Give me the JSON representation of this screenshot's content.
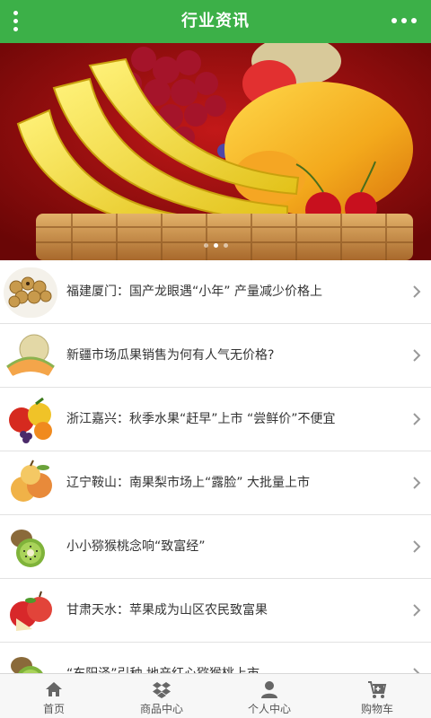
{
  "header": {
    "title": "行业资讯",
    "menu_icon": "vertical-dots-icon",
    "more_icon": "horizontal-dots-icon",
    "bar_color": "#3cb048"
  },
  "banner": {
    "slides": 3,
    "active_slide": 2
  },
  "news": [
    {
      "title": "福建厦门：国产龙眼遇“小年” 产量减少价格上",
      "thumb": "longan"
    },
    {
      "title": "新疆市场瓜果销售为何有人气无价格?",
      "thumb": "melon"
    },
    {
      "title": "浙江嘉兴：秋季水果“赶早”上市 “尝鲜价”不便宜",
      "thumb": "mixed-fruit"
    },
    {
      "title": "辽宁鞍山：南果梨市场上“露脸” 大批量上市",
      "thumb": "pear"
    },
    {
      "title": "小小猕猴桃念响“致富经”",
      "thumb": "kiwi"
    },
    {
      "title": "甘肃天水：苹果成为山区农民致富果",
      "thumb": "apple"
    },
    {
      "title": "“东阳泽”引种 地产红心猕猴桃上市",
      "thumb": "kiwi"
    }
  ],
  "tabbar": {
    "tabs": [
      {
        "label": "首页",
        "icon": "home-icon"
      },
      {
        "label": "商品中心",
        "icon": "dropbox-icon"
      },
      {
        "label": "个人中心",
        "icon": "user-icon"
      },
      {
        "label": "购物车",
        "icon": "cart-icon"
      }
    ]
  }
}
